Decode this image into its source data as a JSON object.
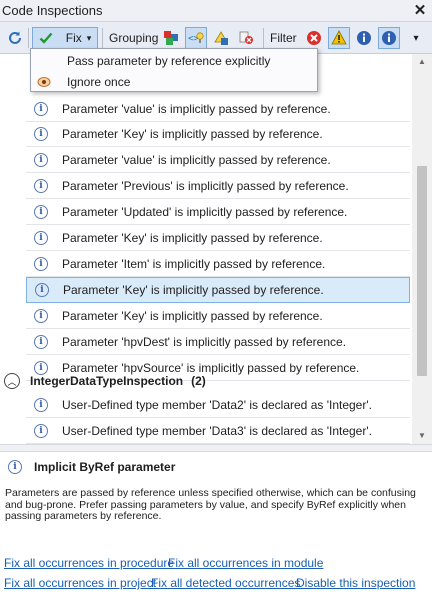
{
  "window": {
    "title": "Code Inspections",
    "close_glyph": "✕"
  },
  "toolbar": {
    "fix_label": "Fix",
    "grouping_label": "Grouping",
    "filter_label": "Filter",
    "dropdown_glyph": "▾",
    "overflow_glyph": "▾"
  },
  "fix_menu": {
    "items": [
      {
        "label": "Pass parameter by reference explicitly"
      },
      {
        "label": "Ignore once"
      }
    ]
  },
  "list": {
    "rows": [
      {
        "text": "Parameter 'value' is implicitly passed by reference."
      },
      {
        "text": "Parameter 'Key' is implicitly passed by reference."
      },
      {
        "text": "Parameter 'value' is implicitly passed by reference."
      },
      {
        "text": "Parameter 'Previous' is implicitly passed by reference."
      },
      {
        "text": "Parameter 'Updated' is implicitly passed by reference."
      },
      {
        "text": "Parameter 'Key' is implicitly passed by reference."
      },
      {
        "text": "Parameter 'Item' is implicitly passed by reference."
      },
      {
        "text": "Parameter 'Key' is implicitly passed by reference.",
        "selected": true
      },
      {
        "text": "Parameter 'Key' is implicitly passed by reference."
      },
      {
        "text": "Parameter 'hpvDest' is implicitly passed by reference."
      },
      {
        "text": "Parameter 'hpvSource' is implicitly passed by reference."
      }
    ],
    "group": {
      "name": "IntegerDataTypeInspection",
      "count": "(2)"
    },
    "group_rows": [
      {
        "text": "User-Defined type member 'Data2' is declared as 'Integer'."
      },
      {
        "text": "User-Defined type member 'Data3' is declared as 'Integer'."
      }
    ]
  },
  "details": {
    "title": "Implicit ByRef parameter",
    "description": "Parameters are passed by reference unless specified otherwise, which can be confusing and bug-prone. Prefer passing parameters by value, and specify ByRef explicitly when passing parameters by reference.",
    "links": {
      "fix_procedure": "Fix all occurrences in procedure",
      "fix_module": "Fix all occurrences in module",
      "fix_project": "Fix all occurrences in project",
      "fix_detected": "Fix all detected occurrences",
      "disable": "Disable this inspection"
    }
  },
  "icons": {
    "refresh": "refresh-icon",
    "fix": "checkmark-icon",
    "group_by_type": "group-by-type-icon",
    "group_by_location": "group-by-location-icon",
    "group_by_severity": "group-by-severity-icon",
    "group_by_inspection": "group-by-inspection-icon",
    "filter_error": "error-icon",
    "filter_warning": "warning-icon",
    "filter_suggestion": "suggestion-icon",
    "filter_hint": "hint-icon",
    "info": "info-icon"
  },
  "colors": {
    "accent": "#1a5fb4",
    "selection": "#d9eaf9",
    "error": "#d9302a",
    "warning": "#f2c200",
    "info": "#2f56a8"
  }
}
